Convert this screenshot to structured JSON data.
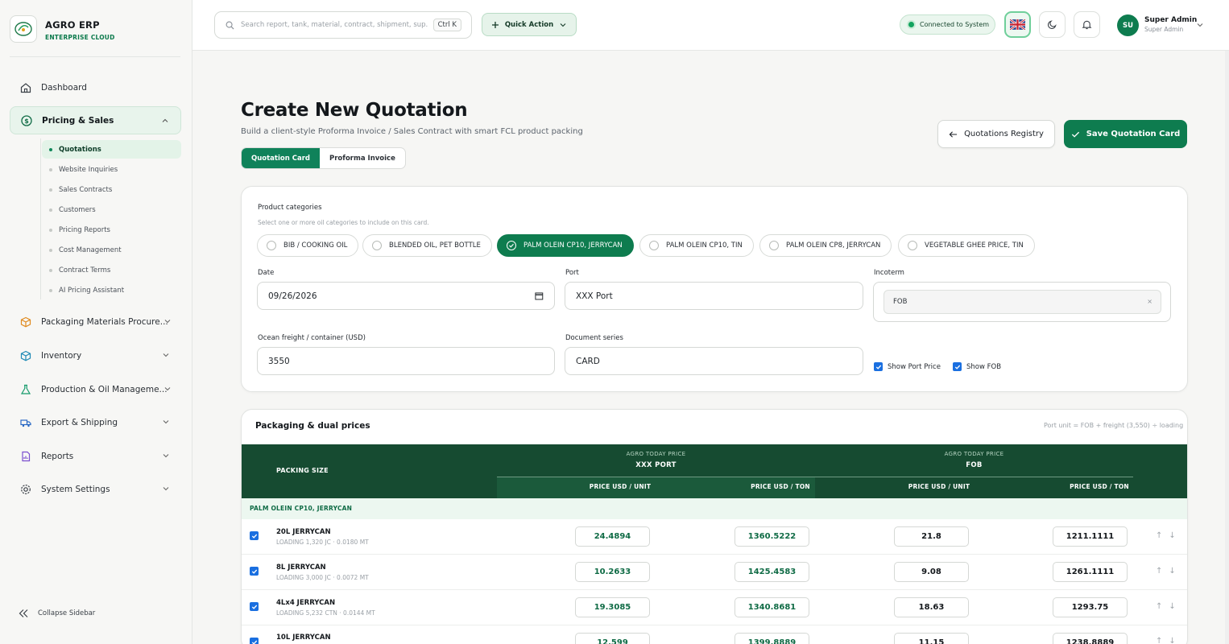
{
  "brand": {
    "name": "AGRO ERP",
    "sub": "ENTERPRISE CLOUD"
  },
  "sidebar": {
    "items": [
      {
        "label": "Dashboard"
      },
      {
        "label": "Pricing & Sales"
      },
      {
        "label": "Packaging Materials Procure..."
      },
      {
        "label": "Inventory"
      },
      {
        "label": "Production & Oil Manageme..."
      },
      {
        "label": "Export & Shipping"
      },
      {
        "label": "Reports"
      },
      {
        "label": "System Settings"
      }
    ],
    "sub_items": [
      {
        "label": "Quotations"
      },
      {
        "label": "Website Inquiries"
      },
      {
        "label": "Sales Contracts"
      },
      {
        "label": "Customers"
      },
      {
        "label": "Pricing Reports"
      },
      {
        "label": "Cost Management"
      },
      {
        "label": "Contract Terms"
      },
      {
        "label": "AI Pricing Assistant"
      }
    ],
    "collapse_label": "Collapse Sidebar"
  },
  "topbar": {
    "search_placeholder": "Search report, tank, material, contract, shipment, sup...",
    "search_shortcut": "Ctrl K",
    "quick_action": "Quick Action",
    "status": "Connected to System",
    "user_initials": "SU",
    "user_name": "Super Admin",
    "user_role": "Super Admin"
  },
  "page": {
    "title": "Create New Quotation",
    "subtitle": "Build a client-style Proforma Invoice / Sales Contract with smart FCL product packing",
    "tabs": [
      {
        "label": "Quotation Card"
      },
      {
        "label": "Proforma Invoice"
      }
    ],
    "registry_button": "Quotations Registry",
    "save_button": "Save Quotation Card"
  },
  "form": {
    "categories_label": "Product categories",
    "categories_hint": "Select one or more oil categories to include on this card.",
    "categories": [
      {
        "label": "BIB / COOKING OIL",
        "selected": false
      },
      {
        "label": "BLENDED OIL, PET BOTTLE",
        "selected": false
      },
      {
        "label": "PALM OLEIN CP10, JERRYCAN",
        "selected": true
      },
      {
        "label": "PALM OLEIN CP10, TIN",
        "selected": false
      },
      {
        "label": "PALM OLEIN CP8, JERRYCAN",
        "selected": false
      },
      {
        "label": "VEGETABLE GHEE PRICE, TIN",
        "selected": false
      }
    ],
    "date_label": "Date",
    "date_value": "09/26/2026",
    "port_label": "Port",
    "port_value": "XXX Port",
    "incoterm_label": "Incoterm",
    "incoterm_value": "FOB",
    "freight_label": "Ocean freight / container (USD)",
    "freight_value": "3550",
    "series_label": "Document series",
    "series_value": "CARD",
    "show_port_price": "Show Port Price",
    "show_fob": "Show FOB"
  },
  "packaging": {
    "title": "Packaging & dual prices",
    "note": "Port unit = FOB + freight (3,550) ÷ loading",
    "col_packing": "PACKING SIZE",
    "group1_sub": "AGRO TODAY PRICE",
    "group1_main": "XXX PORT",
    "group2_sub": "AGRO TODAY PRICE",
    "group2_main": "FOB",
    "col_unit": "PRICE USD / UNIT",
    "col_ton": "PRICE USD / TON",
    "group_label": "PALM OLEIN CP10, JERRYCAN",
    "rows": [
      {
        "name": "20L JERRYCAN",
        "loading": "LOADING 1,320 JC · 0.0180 MT",
        "port_unit": "24.4894",
        "port_ton": "1360.5222",
        "fob_unit": "21.8",
        "fob_ton": "1211.1111"
      },
      {
        "name": "8L JERRYCAN",
        "loading": "LOADING 3,000 JC · 0.0072 MT",
        "port_unit": "10.2633",
        "port_ton": "1425.4583",
        "fob_unit": "9.08",
        "fob_ton": "1261.1111"
      },
      {
        "name": "4Lx4 JERRYCAN",
        "loading": "LOADING 5,232 CTN · 0.0144 MT",
        "port_unit": "19.3085",
        "port_ton": "1340.8681",
        "fob_unit": "18.63",
        "fob_ton": "1293.75"
      },
      {
        "name": "10L JERRYCAN",
        "loading": "",
        "port_unit": "12.599",
        "port_ton": "1399.8889",
        "fob_unit": "11.15",
        "fob_ton": "1238.8889"
      }
    ]
  },
  "colors": {
    "brand_green": "#0e7c4f",
    "table_header": "#164b31",
    "checkbox_blue": "#1a6fe0"
  }
}
